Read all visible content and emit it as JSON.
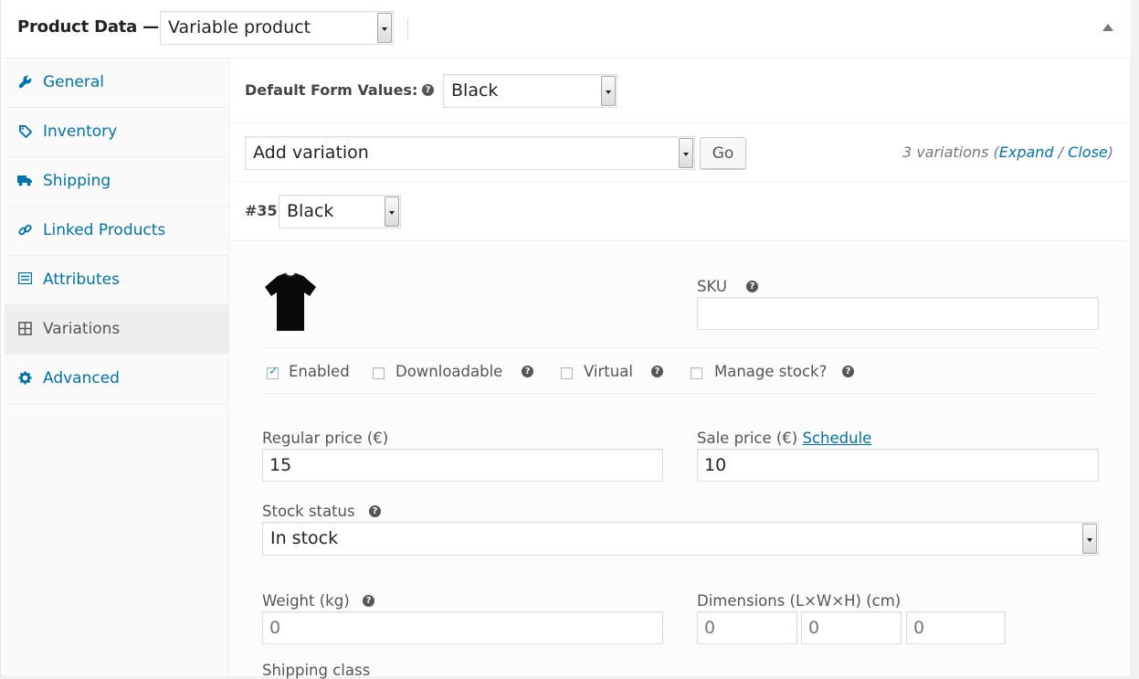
{
  "header": {
    "title": "Product Data —",
    "product_type": "Variable product"
  },
  "sidebar": {
    "items": [
      {
        "label": "General",
        "icon": "wrench-icon"
      },
      {
        "label": "Inventory",
        "icon": "tag-icon"
      },
      {
        "label": "Shipping",
        "icon": "truck-icon"
      },
      {
        "label": "Linked Products",
        "icon": "link-icon"
      },
      {
        "label": "Attributes",
        "icon": "list-icon"
      },
      {
        "label": "Variations",
        "icon": "grid-icon"
      },
      {
        "label": "Advanced",
        "icon": "gear-icon"
      }
    ],
    "active": "Variations"
  },
  "defaults": {
    "label": "Default Form Values:",
    "value": "Black"
  },
  "add_variation": {
    "value": "Add variation",
    "go_label": "Go",
    "count_text": "3 variations",
    "expand_label": "Expand",
    "slash": " / ",
    "close_label": "Close"
  },
  "variation": {
    "id": "#35",
    "color": "Black",
    "sku_label": "SKU",
    "sku_value": "",
    "enabled_label": "Enabled",
    "downloadable_label": "Downloadable",
    "virtual_label": "Virtual",
    "manage_stock_label": "Manage stock?",
    "regular_price_label": "Regular price (€)",
    "regular_price": "15",
    "sale_price_label": "Sale price (€)",
    "schedule_label": "Schedule",
    "sale_price": "10",
    "stock_status_label": "Stock status",
    "stock_status": "In stock",
    "weight_label": "Weight (kg)",
    "weight_placeholder": "0",
    "dimensions_label": "Dimensions (L×W×H) (cm)",
    "length_placeholder": "0",
    "width_placeholder": "0",
    "height_placeholder": "0",
    "shipping_class_label": "Shipping class"
  },
  "colors": {
    "accent": "#0073aa",
    "checkbox_check": "#1e8cbe"
  }
}
